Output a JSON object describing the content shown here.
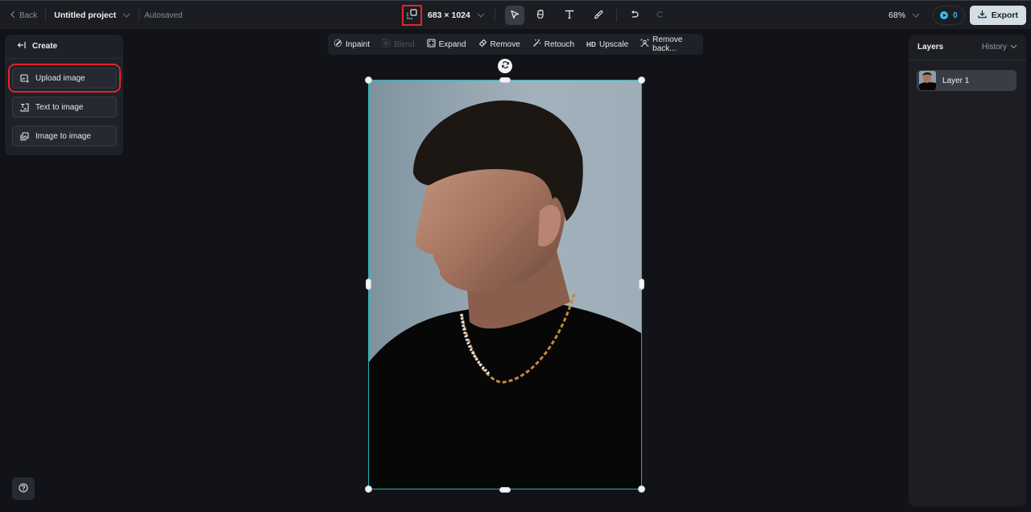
{
  "topbar": {
    "back_label": "Back",
    "project_name": "Untitled project",
    "save_status": "Autosaved",
    "canvas_size": "683 × 1024",
    "zoom_level": "68%",
    "credits": "0",
    "export_label": "Export",
    "tools": [
      {
        "name": "select",
        "icon": "cursor-icon",
        "active": true
      },
      {
        "name": "hand",
        "icon": "hand-icon",
        "active": false
      },
      {
        "name": "text",
        "icon": "text-icon",
        "active": false
      },
      {
        "name": "brush",
        "icon": "brush-icon",
        "active": false
      },
      {
        "name": "undo",
        "icon": "undo-icon",
        "active": false
      },
      {
        "name": "redo",
        "icon": "redo-icon",
        "active": false,
        "disabled": true
      }
    ]
  },
  "left_panel": {
    "header": "Create",
    "buttons": [
      {
        "label": "Upload image",
        "icon": "upload-image-icon",
        "highlighted": true
      },
      {
        "label": "Text to image",
        "icon": "text-to-image-icon"
      },
      {
        "label": "Image to image",
        "icon": "image-to-image-icon"
      }
    ]
  },
  "context_toolbar": {
    "items": [
      {
        "label": "Inpaint",
        "icon": "inpaint-icon"
      },
      {
        "label": "Blend",
        "icon": "blend-icon",
        "disabled": true
      },
      {
        "label": "Expand",
        "icon": "expand-icon"
      },
      {
        "label": "Remove",
        "icon": "eraser-icon"
      },
      {
        "label": "Retouch",
        "icon": "retouch-icon"
      },
      {
        "label": "Upscale",
        "icon": "hd-icon",
        "icon_text": "HD"
      },
      {
        "label": "Remove back...",
        "icon": "remove-background-icon"
      }
    ]
  },
  "right_panel": {
    "title": "Layers",
    "history_label": "History",
    "layers": [
      {
        "label": "Layer 1",
        "selected": true
      }
    ]
  },
  "colors": {
    "selection_border": "#1fb5b5",
    "highlight_red": "#e0262b",
    "credit_accent": "#3fb8e6",
    "export_bg": "#d5dde6"
  }
}
